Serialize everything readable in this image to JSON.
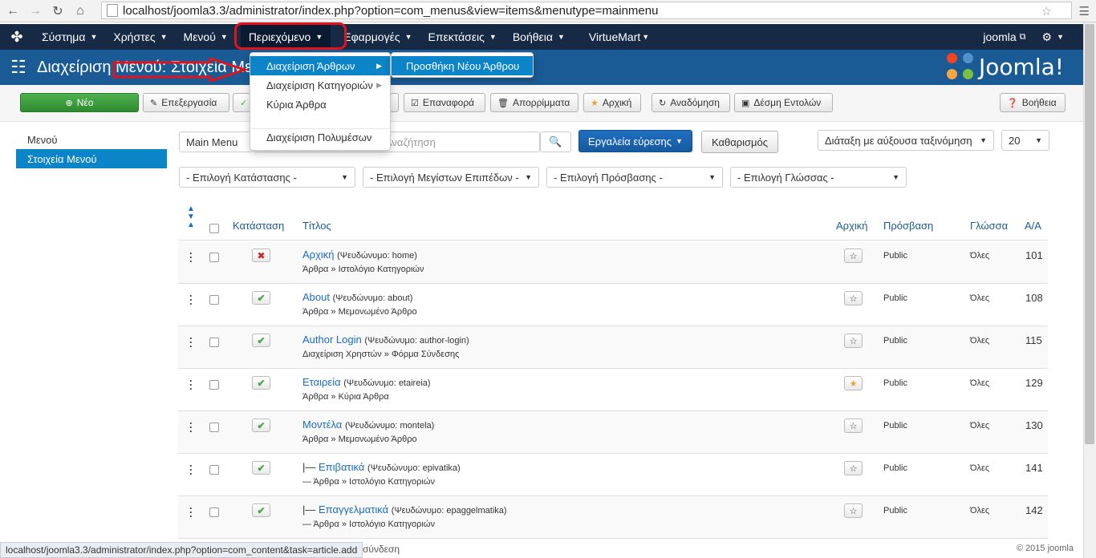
{
  "browser": {
    "url": "localhost/joomla3.3/administrator/index.php?option=com_menus&view=items&menutype=mainmenu",
    "status_url": "localhost/joomla3.3/administrator/index.php?option=com_content&task=article.add"
  },
  "nav": {
    "items": [
      "Σύστημα",
      "Χρήστες",
      "Μενού",
      "Περιεχόμενο",
      "Εφαρμογές",
      "Επεκτάσεις",
      "Βοήθεια",
      "VirtueMart"
    ],
    "user": "joomla",
    "highlight_color": "#e0141e"
  },
  "subhead": {
    "title": "Διαχείριση Μενού: Στοιχεία Μενού",
    "brand": "Joomla!"
  },
  "toolbar": {
    "new": "Νέο",
    "edit": "Επεξεργασία",
    "checkin": "Επαναφορά",
    "trash": "Απορρίμματα",
    "home": "Αρχική",
    "rebuild": "Αναδόμηση",
    "batch": "Δέσμη Εντολών",
    "help": "Βοήθεια"
  },
  "sidebar": {
    "items": [
      "Μενού",
      "Στοιχεία Μενού"
    ]
  },
  "filters": {
    "menu_select": "Main Menu",
    "search_placeholder": "Αναζήτηση",
    "search_tools": "Εργαλεία εύρεσης",
    "clear": "Καθαρισμός",
    "ordering": "Διάταξη με αύξουσα ταξινόμηση",
    "limit": "20",
    "state": "- Επιλογή Κατάστασης -",
    "max_levels": "- Επιλογή Μεγίστων Επιπέδων -",
    "access": "- Επιλογή Πρόσβασης -",
    "language": "- Επιλογή Γλώσσας -"
  },
  "table": {
    "headers": {
      "status": "Κατάσταση",
      "title": "Τίτλος",
      "home": "Αρχική",
      "access": "Πρόσβαση",
      "language": "Γλώσσα",
      "id": "Α/Α"
    },
    "rows": [
      {
        "prefix": "",
        "title": "Αρχική",
        "alias": "(Ψευδώνυμο: home)",
        "type": "Άρθρα » Ιστολόγιο Κατηγοριών",
        "published": false,
        "home": false,
        "access": "Public",
        "language": "Όλες",
        "id": "101"
      },
      {
        "prefix": "",
        "title": "About",
        "alias": "(Ψευδώνυμο: about)",
        "type": "Άρθρα » Μεμονωμένο Άρθρο",
        "published": true,
        "home": false,
        "access": "Public",
        "language": "Όλες",
        "id": "108"
      },
      {
        "prefix": "",
        "title": "Author Login",
        "alias": "(Ψευδώνυμο: author-login)",
        "type": "Διαχείριση Χρηστών » Φόρμα Σύνδεσης",
        "published": true,
        "home": false,
        "access": "Public",
        "language": "Όλες",
        "id": "115"
      },
      {
        "prefix": "",
        "title": "Εταιρεία",
        "alias": "(Ψευδώνυμο: etaireia)",
        "type": "Άρθρα » Κύρια Άρθρα",
        "published": true,
        "home": true,
        "access": "Public",
        "language": "Όλες",
        "id": "129"
      },
      {
        "prefix": "",
        "title": "Μοντέλα",
        "alias": "(Ψευδώνυμο: montela)",
        "type": "Άρθρα » Μεμονωμένο Άρθρο",
        "published": true,
        "home": false,
        "access": "Public",
        "language": "Όλες",
        "id": "130"
      },
      {
        "prefix": "|— ",
        "title": "Επιβατικά",
        "alias": "(Ψευδώνυμο: epivatika)",
        "type": "— Άρθρα » Ιστολόγιο Κατηγοριών",
        "published": true,
        "home": false,
        "access": "Public",
        "language": "Όλες",
        "id": "141"
      },
      {
        "prefix": "|— ",
        "title": "Επαγγελματικά",
        "alias": "(Ψευδώνυμο: epaggelmatika)",
        "type": "— Άρθρα » Ιστολόγιο Κατηγοριών",
        "published": true,
        "home": false,
        "access": "Public",
        "language": "Όλες",
        "id": "142"
      }
    ]
  },
  "dropdown": {
    "items": [
      "Διαχείριση Άρθρων",
      "Διαχείριση Κατηγοριών",
      "Κύρια Άρθρα",
      "Διαχείριση Πολυμέσων"
    ],
    "submenu": "Προσθήκη Νέου Άρθρου"
  },
  "footer": {
    "text": "σύνδεση",
    "copyright": "© 2015 joomla"
  }
}
